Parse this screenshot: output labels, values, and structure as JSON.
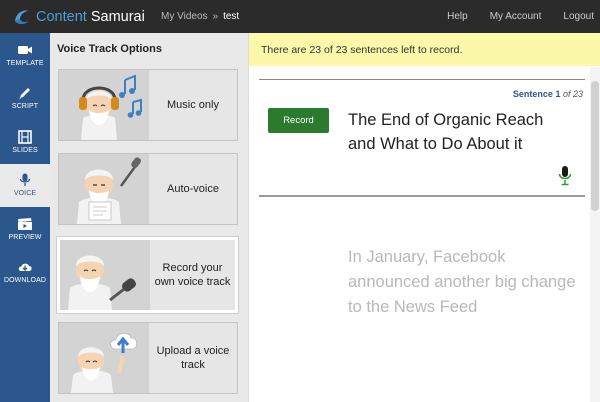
{
  "app": {
    "brand_content": "Content",
    "brand_samurai": "Samurai"
  },
  "breadcrumb": {
    "parent": "My Videos",
    "separator": "»",
    "current": "test"
  },
  "topnav": {
    "help": "Help",
    "account": "My Account",
    "logout": "Logout"
  },
  "sidebar": {
    "items": [
      {
        "label": "TEMPLATE",
        "icon": "video-camera-icon"
      },
      {
        "label": "SCRIPT",
        "icon": "pencil-icon"
      },
      {
        "label": "SLIDES",
        "icon": "film-icon"
      },
      {
        "label": "VOICE",
        "icon": "microphone-icon",
        "active": true
      },
      {
        "label": "PREVIEW",
        "icon": "clapperboard-icon"
      },
      {
        "label": "DOWNLOAD",
        "icon": "cloud-download-icon"
      }
    ]
  },
  "voice_panel": {
    "title": "Voice Track Options",
    "options": [
      {
        "label": "Music only",
        "illustration": "samurai-headphones-music"
      },
      {
        "label": "Auto-voice",
        "illustration": "samurai-reading-paper"
      },
      {
        "label": "Record your own voice track",
        "illustration": "samurai-microphone",
        "selected": true
      },
      {
        "label": "Upload a voice track",
        "illustration": "samurai-cloud-upload"
      }
    ]
  },
  "main": {
    "banner": "There are 23 of 23 sentences left to record.",
    "sentence_label": "Sentence",
    "sentence_number": "1",
    "sentence_of": "of 23",
    "record_button": "Record",
    "current_sentence": "The End of Organic Reach and What to Do About it",
    "next_sentence": "In January, Facebook announced another big change to the News Feed"
  },
  "colors": {
    "sidebar": "#2c578c",
    "record": "#2b7a2e",
    "banner": "#fbf8a9",
    "topbar": "#2b2b2b"
  }
}
